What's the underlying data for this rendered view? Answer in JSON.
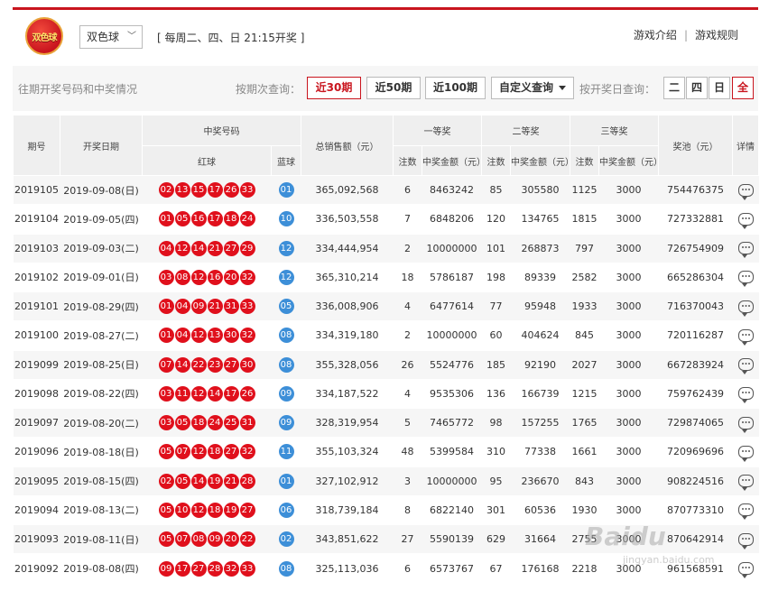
{
  "header": {
    "logo_text": "双色球",
    "game_select": "双色球",
    "schedule": "[ 每周二、四、日 21:15开奖 ]",
    "links": [
      "游戏介绍",
      "游戏规则"
    ]
  },
  "querybar": {
    "title": "往期开奖号码和中奖情况",
    "period_label": "按期次查询：",
    "period_buttons": [
      "近30期",
      "近50期",
      "近100期",
      "自定义查询"
    ],
    "active_period": "近30期",
    "date_label": "按开奖日查询：",
    "day_buttons": [
      "二",
      "四",
      "日",
      "全"
    ],
    "active_day": "全"
  },
  "table_headers": {
    "issue": "期号",
    "date": "开奖日期",
    "numbers": "中奖号码",
    "red": "红球",
    "blue": "蓝球",
    "sales": "总销售额（元）",
    "first": "一等奖",
    "second": "二等奖",
    "third": "三等奖",
    "count": "注数",
    "amount": "中奖金额（元）",
    "pool": "奖池（元）",
    "detail": "详情"
  },
  "rows": [
    {
      "issue": "2019105",
      "date": "2019-09-08(日)",
      "red": [
        "02",
        "13",
        "15",
        "17",
        "26",
        "33"
      ],
      "blue": "01",
      "sales": "365,092,568",
      "n1": "6",
      "a1": "8463242",
      "n2": "85",
      "a2": "305580",
      "n3": "1125",
      "a3": "3000",
      "pool": "754476375"
    },
    {
      "issue": "2019104",
      "date": "2019-09-05(四)",
      "red": [
        "01",
        "05",
        "16",
        "17",
        "18",
        "24"
      ],
      "blue": "10",
      "sales": "336,503,558",
      "n1": "7",
      "a1": "6848206",
      "n2": "120",
      "a2": "134765",
      "n3": "1815",
      "a3": "3000",
      "pool": "727332881"
    },
    {
      "issue": "2019103",
      "date": "2019-09-03(二)",
      "red": [
        "04",
        "12",
        "14",
        "21",
        "27",
        "29"
      ],
      "blue": "12",
      "sales": "334,444,954",
      "n1": "2",
      "a1": "10000000",
      "n2": "101",
      "a2": "268873",
      "n3": "797",
      "a3": "3000",
      "pool": "726754909"
    },
    {
      "issue": "2019102",
      "date": "2019-09-01(日)",
      "red": [
        "03",
        "08",
        "12",
        "16",
        "20",
        "32"
      ],
      "blue": "12",
      "sales": "365,310,214",
      "n1": "18",
      "a1": "5786187",
      "n2": "198",
      "a2": "89339",
      "n3": "2582",
      "a3": "3000",
      "pool": "665286304"
    },
    {
      "issue": "2019101",
      "date": "2019-08-29(四)",
      "red": [
        "01",
        "04",
        "09",
        "21",
        "31",
        "33"
      ],
      "blue": "05",
      "sales": "336,008,906",
      "n1": "4",
      "a1": "6477614",
      "n2": "77",
      "a2": "95948",
      "n3": "1933",
      "a3": "3000",
      "pool": "716370043"
    },
    {
      "issue": "2019100",
      "date": "2019-08-27(二)",
      "red": [
        "01",
        "04",
        "12",
        "13",
        "30",
        "32"
      ],
      "blue": "08",
      "sales": "334,319,180",
      "n1": "2",
      "a1": "10000000",
      "n2": "60",
      "a2": "404624",
      "n3": "845",
      "a3": "3000",
      "pool": "720116287"
    },
    {
      "issue": "2019099",
      "date": "2019-08-25(日)",
      "red": [
        "07",
        "14",
        "22",
        "23",
        "27",
        "30"
      ],
      "blue": "08",
      "sales": "355,328,056",
      "n1": "26",
      "a1": "5524776",
      "n2": "185",
      "a2": "92190",
      "n3": "2027",
      "a3": "3000",
      "pool": "667283924"
    },
    {
      "issue": "2019098",
      "date": "2019-08-22(四)",
      "red": [
        "03",
        "11",
        "12",
        "14",
        "17",
        "26"
      ],
      "blue": "09",
      "sales": "334,187,522",
      "n1": "4",
      "a1": "9535306",
      "n2": "136",
      "a2": "166739",
      "n3": "1215",
      "a3": "3000",
      "pool": "759762439"
    },
    {
      "issue": "2019097",
      "date": "2019-08-20(二)",
      "red": [
        "03",
        "05",
        "18",
        "24",
        "25",
        "31"
      ],
      "blue": "09",
      "sales": "328,319,954",
      "n1": "5",
      "a1": "7465772",
      "n2": "98",
      "a2": "157255",
      "n3": "1765",
      "a3": "3000",
      "pool": "729874065"
    },
    {
      "issue": "2019096",
      "date": "2019-08-18(日)",
      "red": [
        "05",
        "07",
        "12",
        "18",
        "27",
        "32"
      ],
      "blue": "11",
      "sales": "355,103,324",
      "n1": "48",
      "a1": "5399584",
      "n2": "310",
      "a2": "77338",
      "n3": "1661",
      "a3": "3000",
      "pool": "720969696"
    },
    {
      "issue": "2019095",
      "date": "2019-08-15(四)",
      "red": [
        "02",
        "05",
        "14",
        "19",
        "21",
        "28"
      ],
      "blue": "01",
      "sales": "327,102,912",
      "n1": "3",
      "a1": "10000000",
      "n2": "95",
      "a2": "236670",
      "n3": "843",
      "a3": "3000",
      "pool": "908224516"
    },
    {
      "issue": "2019094",
      "date": "2019-08-13(二)",
      "red": [
        "05",
        "10",
        "12",
        "18",
        "19",
        "27"
      ],
      "blue": "06",
      "sales": "318,739,184",
      "n1": "8",
      "a1": "6822140",
      "n2": "301",
      "a2": "60536",
      "n3": "1930",
      "a3": "3000",
      "pool": "870773310"
    },
    {
      "issue": "2019093",
      "date": "2019-08-11(日)",
      "red": [
        "05",
        "07",
        "08",
        "09",
        "20",
        "22"
      ],
      "blue": "02",
      "sales": "343,851,622",
      "n1": "27",
      "a1": "5590139",
      "n2": "629",
      "a2": "31664",
      "n3": "2755",
      "a3": "3000",
      "pool": "870642914"
    },
    {
      "issue": "2019092",
      "date": "2019-08-08(四)",
      "red": [
        "09",
        "17",
        "27",
        "28",
        "32",
        "33"
      ],
      "blue": "08",
      "sales": "325,113,036",
      "n1": "6",
      "a1": "6573767",
      "n2": "67",
      "a2": "176168",
      "n3": "2218",
      "a3": "3000",
      "pool": "961568591"
    }
  ],
  "watermark": "Baidu",
  "watermark_sub": "jingyan.baidu.com",
  "colors": {
    "accent_red": "#c9151e",
    "red_ball": "#e0101c",
    "blue_ball": "#3d8fd8"
  }
}
